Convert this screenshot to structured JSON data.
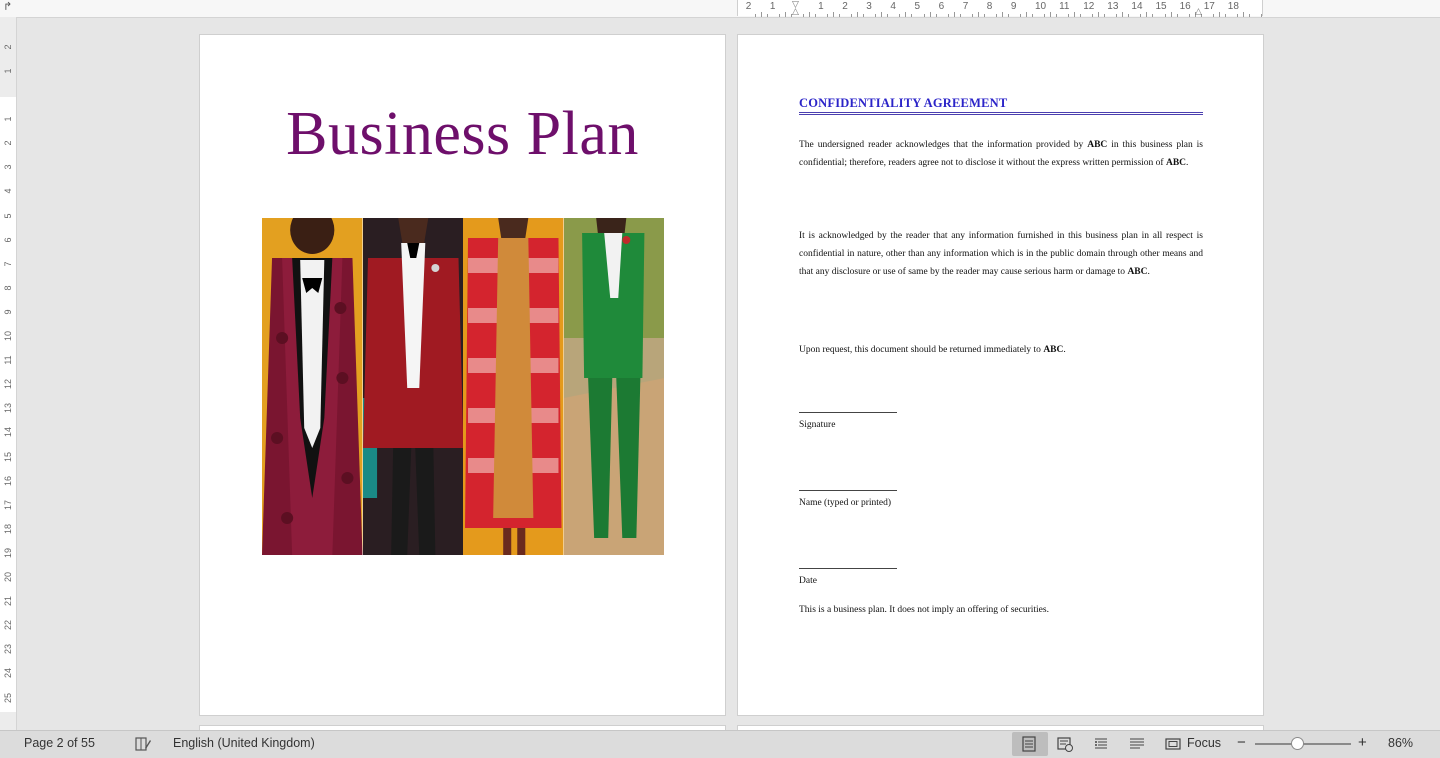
{
  "ruler": {
    "corner_symbol": "↱",
    "top_numbers": [
      "2",
      "1",
      "1",
      "2",
      "3",
      "4",
      "5",
      "6",
      "7",
      "8",
      "9",
      "10",
      "11",
      "12",
      "13",
      "14",
      "15",
      "16",
      "17",
      "18"
    ],
    "left_numbers": [
      "2",
      "1",
      "1",
      "2",
      "3",
      "4",
      "5",
      "6",
      "7",
      "8",
      "9",
      "10",
      "11",
      "12",
      "13",
      "14",
      "15",
      "16",
      "17",
      "18",
      "19",
      "20",
      "21",
      "22",
      "23",
      "24",
      "25"
    ]
  },
  "left_page": {
    "title": "Business Plan",
    "image_icon": "cover-photo-four-outfits"
  },
  "right_page": {
    "heading": "CONFIDENTIALITY AGREEMENT",
    "para1": {
      "t1": "The undersigned reader acknowledges that the information provided by ",
      "b1": "ABC",
      "t2": " in this business plan is confidential; therefore, readers agree not to disclose it without the express written permission of ",
      "b2": "ABC",
      "t3": "."
    },
    "para2": {
      "t1": "It is acknowledged by the reader that any information furnished in this business plan in all respect is confidential in nature, other than any information which is in the public domain through other means and that any disclosure or use of same by the reader may cause serious harm or damage to ",
      "b1": "ABC",
      "t2": "."
    },
    "para3": {
      "t1": "Upon request, this document should be returned immediately to ",
      "b1": "ABC",
      "t2": "."
    },
    "signature_label": "Signature",
    "name_label": "Name (typed or printed)",
    "date_label": "Date",
    "disclaimer": "This is a business plan. It does not imply an offering of securities."
  },
  "status_bar": {
    "page_info": "Page 2 of 55",
    "language": "English (United Kingdom)",
    "focus_label": "Focus",
    "zoom_minus": "−",
    "zoom_plus": "+",
    "zoom_percent": "86%",
    "zoom_level": 0.86
  },
  "colors": {
    "title": "#6e0f6b",
    "heading": "#2b24c8",
    "status_bar": "#dcdcdc"
  }
}
